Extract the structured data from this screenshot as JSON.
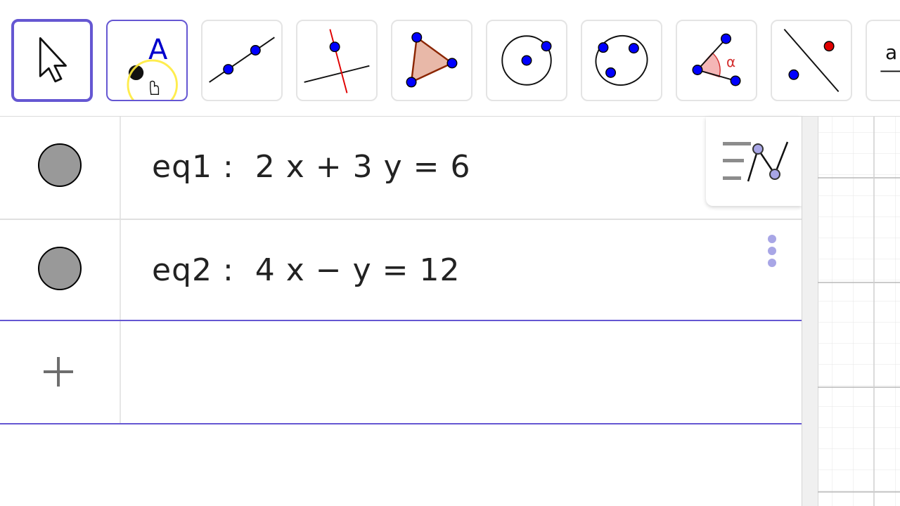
{
  "toolbar": {
    "tools": [
      {
        "name": "Move",
        "icon": "move-arrow-icon"
      },
      {
        "name": "Point",
        "icon": "point-icon",
        "label": "A"
      },
      {
        "name": "Line",
        "icon": "line-through-two-points-icon"
      },
      {
        "name": "Perpendicular Line",
        "icon": "perpendicular-line-icon"
      },
      {
        "name": "Polygon",
        "icon": "polygon-icon"
      },
      {
        "name": "Circle with Center through Point",
        "icon": "circle-center-point-icon"
      },
      {
        "name": "Ellipse",
        "icon": "ellipse-icon"
      },
      {
        "name": "Angle",
        "icon": "angle-icon",
        "label": "α"
      },
      {
        "name": "Reflect about Line",
        "icon": "reflect-line-icon"
      },
      {
        "name": "Slider",
        "icon": "slider-icon",
        "label": "a"
      }
    ],
    "selected": "Move",
    "hovered": "Point"
  },
  "algebra": {
    "rows": [
      {
        "expression": "eq1 :  2 x + 3 y = 6",
        "visible": true
      },
      {
        "expression": "eq2 :  4 x − y = 12",
        "visible": true
      }
    ],
    "input_placeholder": ""
  },
  "colors": {
    "accent": "#6557d2",
    "point_blue": "#0000ff",
    "marble": "#999999",
    "angle_red": "#d32f2f"
  }
}
